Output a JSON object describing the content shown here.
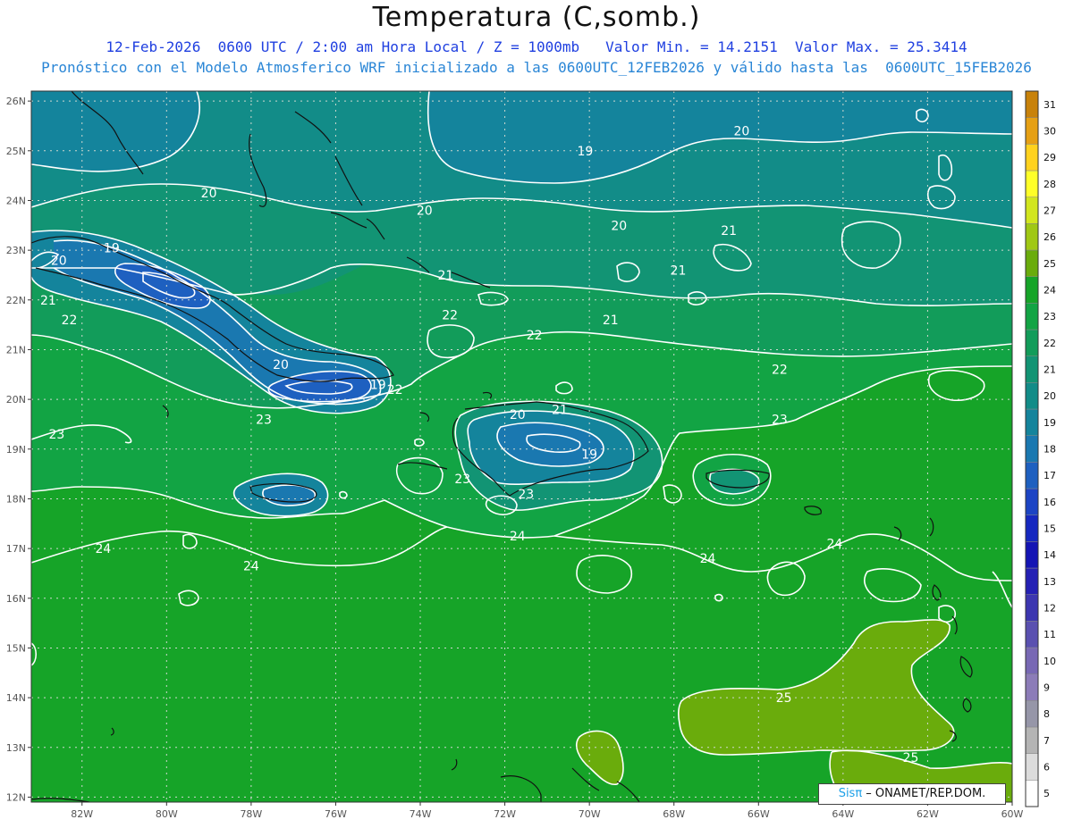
{
  "title": "Temperatura (C,somb.)",
  "subtitle1": "12-Feb-2026  0600 UTC / 2:00 am Hora Local / Z = 1000mb   Valor Min. = 14.2151  Valor Max. = 25.3414",
  "subtitle2": "Pronóstico con el Modelo Atmosferico WRF inicializado a las 0600UTC_12FEB2026 y válido hasta las  0600UTC_15FEB2026",
  "credit": {
    "brand": "Sisπ",
    "text": " – ONAMET/REP.DOM."
  },
  "lat_labels": [
    "26N",
    "25N",
    "24N",
    "23N",
    "22N",
    "21N",
    "20N",
    "19N",
    "18N",
    "17N",
    "16N",
    "15N",
    "14N",
    "13N",
    "12N"
  ],
  "lon_labels": [
    "82W",
    "80W",
    "78W",
    "76W",
    "74W",
    "72W",
    "70W",
    "68W",
    "66W",
    "64W",
    "62W",
    "60W"
  ],
  "colorbar": [
    {
      "label": "5",
      "color": "#ffffff"
    },
    {
      "label": "6",
      "color": "#dcdcdc"
    },
    {
      "label": "7",
      "color": "#b4b4b4"
    },
    {
      "label": "8",
      "color": "#9696a8"
    },
    {
      "label": "9",
      "color": "#8c7cb8"
    },
    {
      "label": "10",
      "color": "#7868b4"
    },
    {
      "label": "11",
      "color": "#5a50b0"
    },
    {
      "label": "12",
      "color": "#3c36b0"
    },
    {
      "label": "13",
      "color": "#2420b4"
    },
    {
      "label": "14",
      "color": "#1414b4"
    },
    {
      "label": "15",
      "color": "#1628c0"
    },
    {
      "label": "16",
      "color": "#1c44c4"
    },
    {
      "label": "17",
      "color": "#1e60c0"
    },
    {
      "label": "18",
      "color": "#1a78b0"
    },
    {
      "label": "19",
      "color": "#14849c"
    },
    {
      "label": "20",
      "color": "#128c88"
    },
    {
      "label": "21",
      "color": "#129474"
    },
    {
      "label": "22",
      "color": "#129c5a"
    },
    {
      "label": "23",
      "color": "#12a444"
    },
    {
      "label": "24",
      "color": "#16a428"
    },
    {
      "label": "25",
      "color": "#6aac0c"
    },
    {
      "label": "26",
      "color": "#a0c814"
    },
    {
      "label": "27",
      "color": "#d2e61e"
    },
    {
      "label": "28",
      "color": "#ffff28"
    },
    {
      "label": "29",
      "color": "#ffd21e"
    },
    {
      "label": "30",
      "color": "#e6a014"
    },
    {
      "label": "31",
      "color": "#c8820a"
    }
  ],
  "contour_labels": [
    {
      "text": "19",
      "lon": -81.3,
      "lat": 23.05
    },
    {
      "text": "20",
      "lon": -82.55,
      "lat": 22.8
    },
    {
      "text": "21",
      "lon": -82.8,
      "lat": 22.0
    },
    {
      "text": "22",
      "lon": -82.3,
      "lat": 21.6
    },
    {
      "text": "20",
      "lon": -79.0,
      "lat": 24.15
    },
    {
      "text": "20",
      "lon": -73.9,
      "lat": 23.8
    },
    {
      "text": "21",
      "lon": -73.4,
      "lat": 22.5
    },
    {
      "text": "22",
      "lon": -73.3,
      "lat": 21.7
    },
    {
      "text": "19",
      "lon": -70.1,
      "lat": 25.0
    },
    {
      "text": "20",
      "lon": -66.4,
      "lat": 25.4
    },
    {
      "text": "20",
      "lon": -69.3,
      "lat": 23.5
    },
    {
      "text": "21",
      "lon": -66.7,
      "lat": 23.4
    },
    {
      "text": "21",
      "lon": -67.9,
      "lat": 22.6
    },
    {
      "text": "21",
      "lon": -69.5,
      "lat": 21.6
    },
    {
      "text": "22",
      "lon": -71.3,
      "lat": 21.3
    },
    {
      "text": "22",
      "lon": -65.5,
      "lat": 20.6
    },
    {
      "text": "20",
      "lon": -77.3,
      "lat": 20.7
    },
    {
      "text": "19",
      "lon": -75.0,
      "lat": 20.3
    },
    {
      "text": "22",
      "lon": -74.6,
      "lat": 20.2
    },
    {
      "text": "23",
      "lon": -77.7,
      "lat": 19.6
    },
    {
      "text": "23",
      "lon": -82.6,
      "lat": 19.3
    },
    {
      "text": "20",
      "lon": -71.7,
      "lat": 19.7
    },
    {
      "text": "21",
      "lon": -70.7,
      "lat": 19.8
    },
    {
      "text": "19",
      "lon": -70.0,
      "lat": 18.9
    },
    {
      "text": "23",
      "lon": -73.0,
      "lat": 18.4
    },
    {
      "text": "23",
      "lon": -71.5,
      "lat": 18.1
    },
    {
      "text": "23",
      "lon": -65.5,
      "lat": 19.6
    },
    {
      "text": "24",
      "lon": -81.5,
      "lat": 17.0
    },
    {
      "text": "24",
      "lon": -78.0,
      "lat": 16.65
    },
    {
      "text": "24",
      "lon": -71.7,
      "lat": 17.25
    },
    {
      "text": "24",
      "lon": -64.2,
      "lat": 17.1
    },
    {
      "text": "24",
      "lon": -67.2,
      "lat": 16.8
    },
    {
      "text": "25",
      "lon": -65.4,
      "lat": 14.0
    },
    {
      "text": "25",
      "lon": -62.4,
      "lat": 12.8
    }
  ]
}
